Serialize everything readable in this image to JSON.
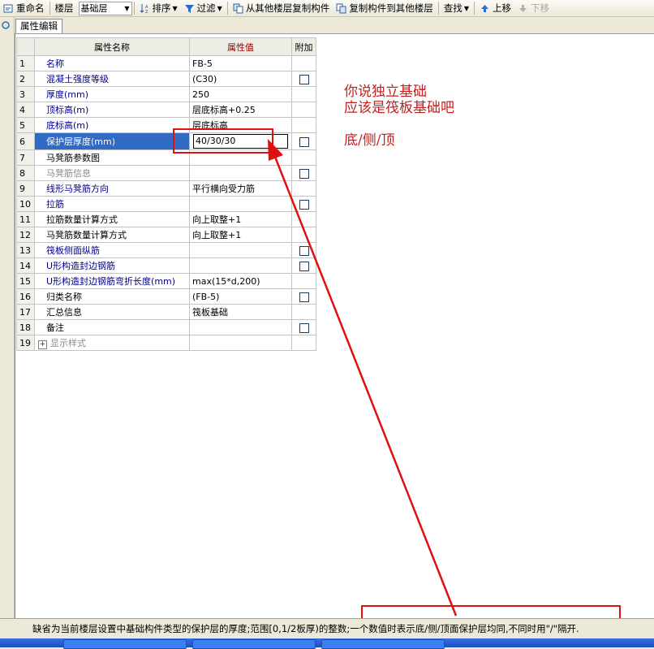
{
  "toolbar": {
    "rename": "重命名",
    "floor_label": "楼层",
    "floor_value": "基础层",
    "sort": "排序",
    "filter": "过滤",
    "copy_from": "从其他楼层复制构件",
    "copy_to": "复制构件到其他楼层",
    "find": "查找",
    "move_up": "上移",
    "move_down": "下移"
  },
  "tab": {
    "label": "属性编辑"
  },
  "grid": {
    "col_name": "属性名称",
    "col_value": "属性值",
    "col_add": "附加",
    "rows": [
      {
        "num": "1",
        "name": "名称",
        "value": "FB-5"
      },
      {
        "num": "2",
        "name": "混凝土强度等级",
        "value": "(C30)"
      },
      {
        "num": "3",
        "name": "厚度(mm)",
        "value": "250"
      },
      {
        "num": "4",
        "name": "顶标高(m)",
        "value": "层底标高+0.25"
      },
      {
        "num": "5",
        "name": "底标高(m)",
        "value": "层底标高"
      },
      {
        "num": "6",
        "name": "保护层厚度(mm)",
        "value": "40/30/30"
      },
      {
        "num": "7",
        "name": "马凳筋参数图",
        "value": ""
      },
      {
        "num": "8",
        "name": "马凳筋信息",
        "value": ""
      },
      {
        "num": "9",
        "name": "线形马凳筋方向",
        "value": "平行横向受力筋"
      },
      {
        "num": "10",
        "name": "拉筋",
        "value": ""
      },
      {
        "num": "11",
        "name": "拉筋数量计算方式",
        "value": "向上取整+1"
      },
      {
        "num": "12",
        "name": "马凳筋数量计算方式",
        "value": "向上取整+1"
      },
      {
        "num": "13",
        "name": "筏板侧面纵筋",
        "value": ""
      },
      {
        "num": "14",
        "name": "U形构造封边钢筋",
        "value": ""
      },
      {
        "num": "15",
        "name": "U形构造封边钢筋弯折长度(mm)",
        "value": "max(15*d,200)"
      },
      {
        "num": "16",
        "name": "归类名称",
        "value": "(FB-5)"
      },
      {
        "num": "17",
        "name": "汇总信息",
        "value": "筏板基础"
      },
      {
        "num": "18",
        "name": "备注",
        "value": ""
      },
      {
        "num": "19",
        "name": "显示样式",
        "value": ""
      }
    ]
  },
  "annotation": {
    "line1": "你说独立基础",
    "line2": "应该是筏板基础吧",
    "line3": "底/侧/顶"
  },
  "status": {
    "text": "缺省为当前楼层设置中基础构件类型的保护层的厚度;范围[0,1/2板厚)的整数;一个数值时表示底/侧/顶面保护层均同,不同时用\"/\"隔开."
  },
  "colors": {
    "annotation_red": "#e01010",
    "selection_blue": "#316ac5",
    "header_value_bg": "#f9d783"
  }
}
